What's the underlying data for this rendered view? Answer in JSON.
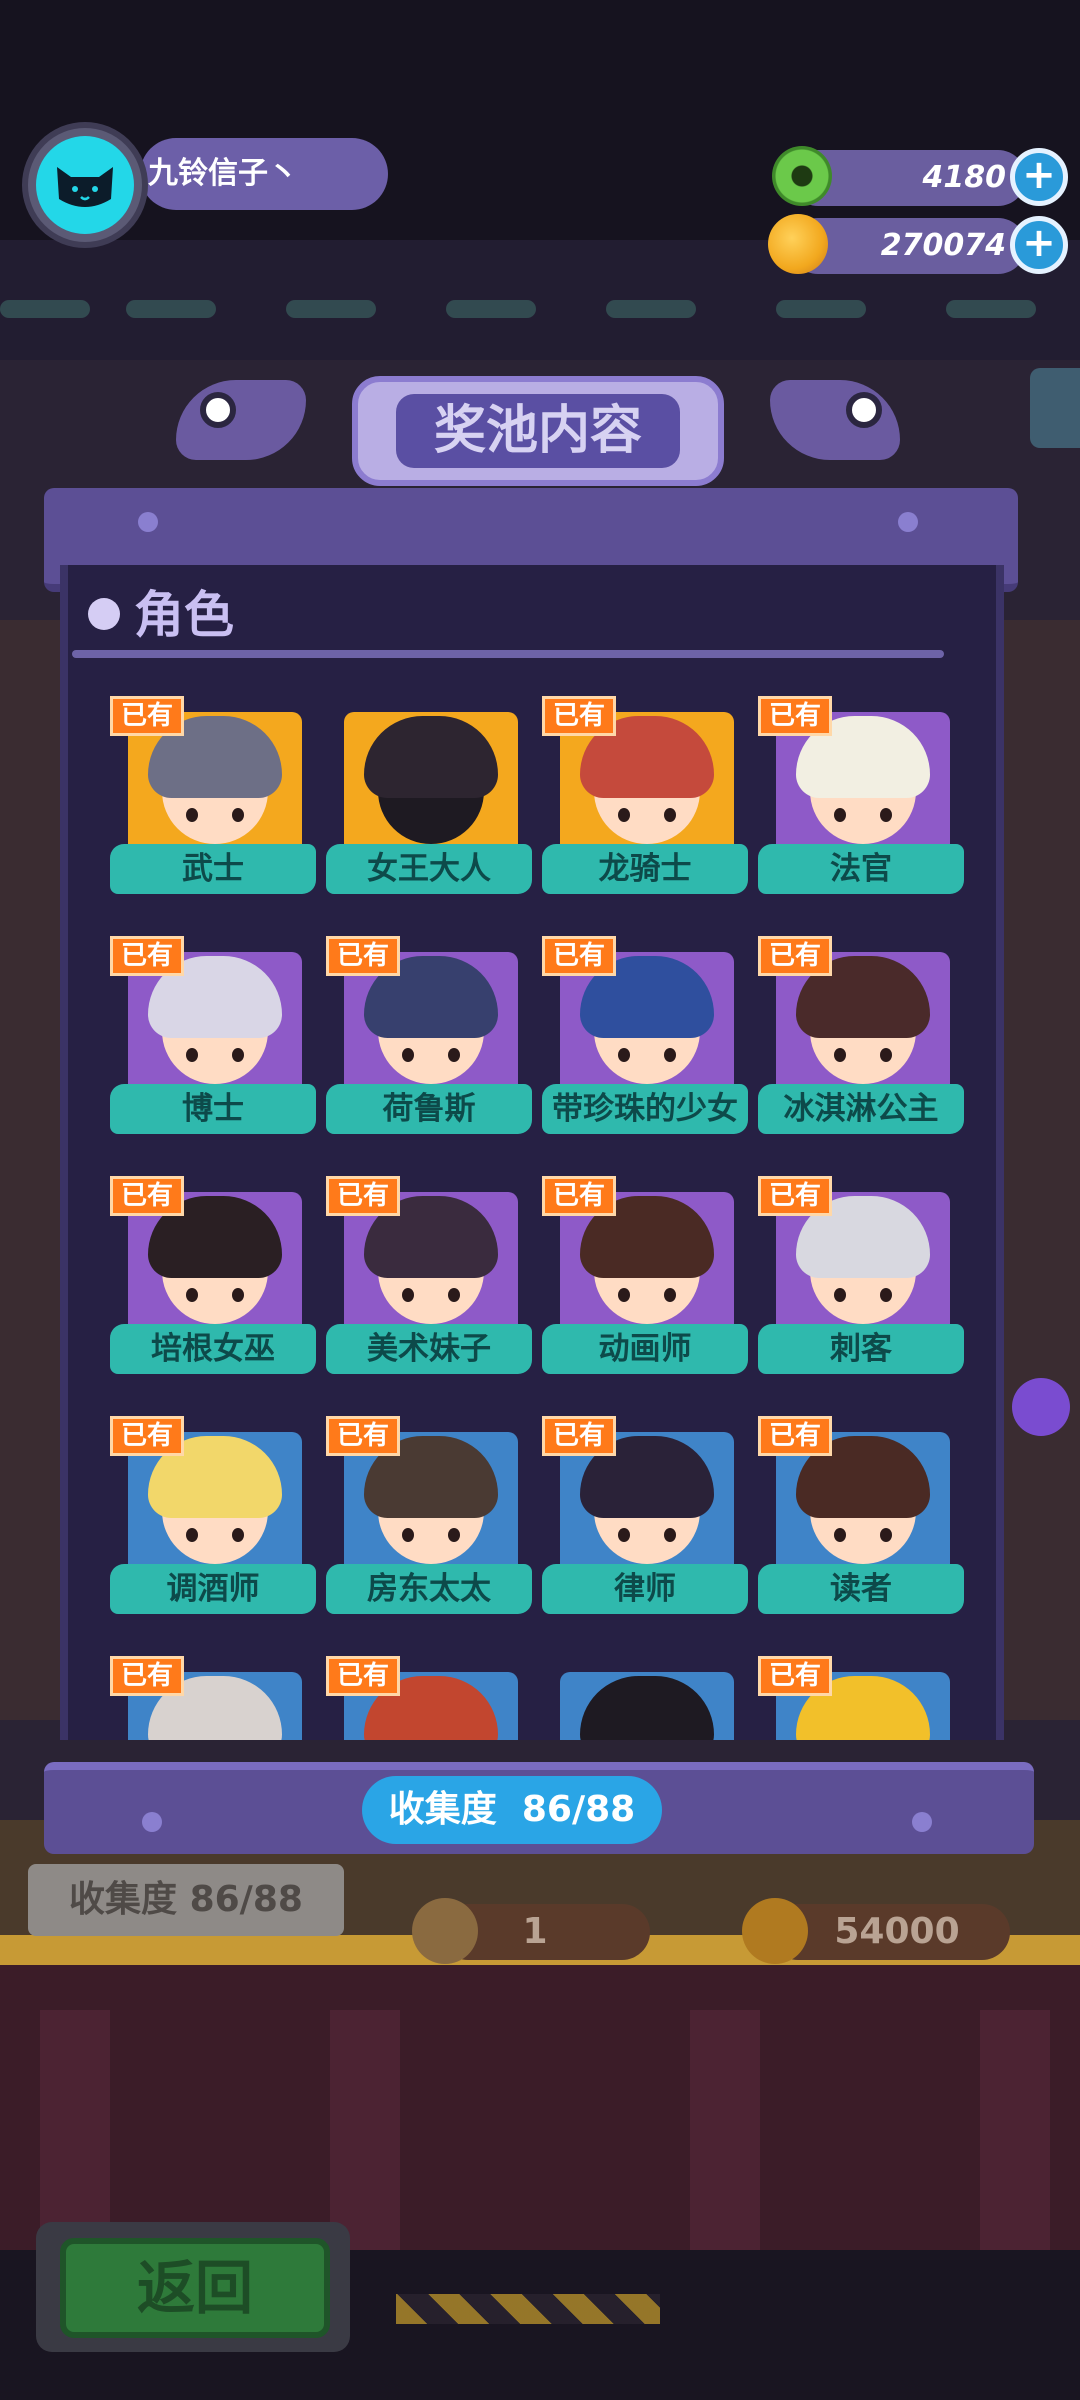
{
  "player": {
    "name": "九铃信子丶",
    "avatar_icon": "cat-avatar-icon"
  },
  "currencies": [
    {
      "name": "donut",
      "icon": "donut-icon",
      "value": "4180",
      "color": "#6bc94a"
    },
    {
      "name": "planet-coin",
      "icon": "planet-coin-icon",
      "value": "270074",
      "color": "#f2a81e"
    }
  ],
  "modal": {
    "title": "奖池内容",
    "section_title": "角色",
    "owned_badge": "已有",
    "characters": [
      {
        "name": "武士",
        "owned": true,
        "bg": "#f4a81e",
        "hair": "#6d6f86"
      },
      {
        "name": "女王大人",
        "owned": false,
        "bg": "#f4a81e",
        "hair": "#2d2530"
      },
      {
        "name": "龙骑士",
        "owned": true,
        "bg": "#f4a81e",
        "hair": "#c54a3c"
      },
      {
        "name": "法官",
        "owned": true,
        "bg": "#8e5ac8",
        "hair": "#f2efe2"
      },
      {
        "name": "博士",
        "owned": true,
        "bg": "#8e5ac8",
        "hair": "#d9d6e6"
      },
      {
        "name": "荷鲁斯",
        "owned": true,
        "bg": "#8e5ac8",
        "hair": "#37406e"
      },
      {
        "name": "带珍珠的少女",
        "owned": true,
        "bg": "#8e5ac8",
        "hair": "#2f4f9e"
      },
      {
        "name": "冰淇淋公主",
        "owned": true,
        "bg": "#8e5ac8",
        "hair": "#4a2a2a"
      },
      {
        "name": "培根女巫",
        "owned": true,
        "bg": "#8e5ac8",
        "hair": "#2a1f23"
      },
      {
        "name": "美术妹子",
        "owned": true,
        "bg": "#8e5ac8",
        "hair": "#3a2b3e"
      },
      {
        "name": "动画师",
        "owned": true,
        "bg": "#8e5ac8",
        "hair": "#4a2a24"
      },
      {
        "name": "刺客",
        "owned": true,
        "bg": "#8e5ac8",
        "hair": "#d8d8e0"
      },
      {
        "name": "调酒师",
        "owned": true,
        "bg": "#3f84c8",
        "hair": "#f2d76a"
      },
      {
        "name": "房东太太",
        "owned": true,
        "bg": "#3f84c8",
        "hair": "#4a3a33"
      },
      {
        "name": "律师",
        "owned": true,
        "bg": "#3f84c8",
        "hair": "#2a2238"
      },
      {
        "name": "读者",
        "owned": true,
        "bg": "#3f84c8",
        "hair": "#4a2a24"
      },
      {
        "name": "",
        "owned": true,
        "bg": "#3f84c8",
        "hair": "#d8d2cf"
      },
      {
        "name": "",
        "owned": true,
        "bg": "#3f84c8",
        "hair": "#c2462f"
      },
      {
        "name": "",
        "owned": false,
        "bg": "#3f84c8",
        "hair": "#1e1a22"
      },
      {
        "name": "",
        "owned": true,
        "bg": "#3f84c8",
        "hair": "#f2c02a"
      }
    ],
    "collection_label": "收集度",
    "collection_value": "86/88"
  },
  "background": {
    "collection_plaque": "收集度   86/88",
    "ticket_count": "1",
    "price": "54000",
    "back_button": "返回"
  }
}
